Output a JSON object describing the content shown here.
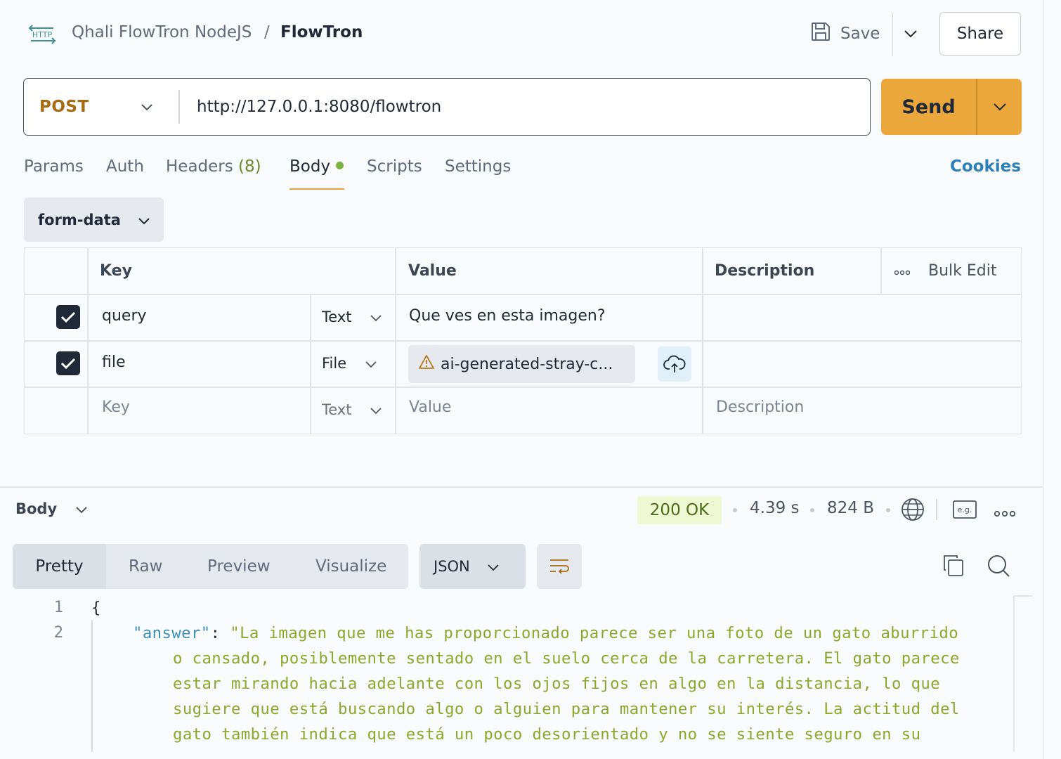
{
  "header": {
    "icon": "http-icon",
    "workspace": "Qhali FlowTron NodeJS",
    "separator": "/",
    "request_name": "FlowTron",
    "save_label": "Save",
    "share_label": "Share"
  },
  "request": {
    "method": "POST",
    "url": "http://127.0.0.1:8080/flowtron",
    "send_label": "Send"
  },
  "tabs": {
    "params": "Params",
    "auth": "Auth",
    "headers": "Headers",
    "headers_count": "(8)",
    "body": "Body",
    "scripts": "Scripts",
    "settings": "Settings",
    "cookies": "Cookies"
  },
  "body": {
    "type": "form-data",
    "columns": {
      "key": "Key",
      "value": "Value",
      "description": "Description",
      "bulk_edit": "Bulk Edit"
    },
    "rows": [
      {
        "checked": true,
        "key": "query",
        "type": "Text",
        "value": "Que ves en esta imagen?",
        "description": ""
      },
      {
        "checked": true,
        "key": "file",
        "type": "File",
        "value": "ai-generated-stray-c...",
        "description": ""
      }
    ],
    "placeholder_row": {
      "key": "Key",
      "type": "Text",
      "value": "Value",
      "description": "Description"
    }
  },
  "response": {
    "section_label": "Body",
    "status": "200 OK",
    "time": "4.39 s",
    "size": "824 B",
    "view_tabs": {
      "pretty": "Pretty",
      "raw": "Raw",
      "preview": "Preview",
      "visualize": "Visualize"
    },
    "format": "JSON",
    "line_numbers": [
      "1",
      "2"
    ],
    "code": {
      "open_brace": "{",
      "key": "\"answer\"",
      "colon": ": ",
      "lines": [
        "\"La imagen que me has proporcionado parece ser una foto de un gato aburrido",
        "o cansado, posiblemente sentado en el suelo cerca de la carretera. El gato parece",
        "estar mirando hacia adelante con los ojos fijos en algo en la distancia, lo que",
        "sugiere que está buscando algo o alguien para mantener su interés. La actitud del",
        "gato también indica que está un poco desorientado y no se siente seguro en su"
      ]
    }
  },
  "colors": {
    "accent": "#eba63c",
    "method": "#a86b10",
    "link": "#2c7fb8",
    "status_bg": "#eef8d2",
    "json_key": "#3b90b6",
    "json_string": "#8ca82c"
  }
}
